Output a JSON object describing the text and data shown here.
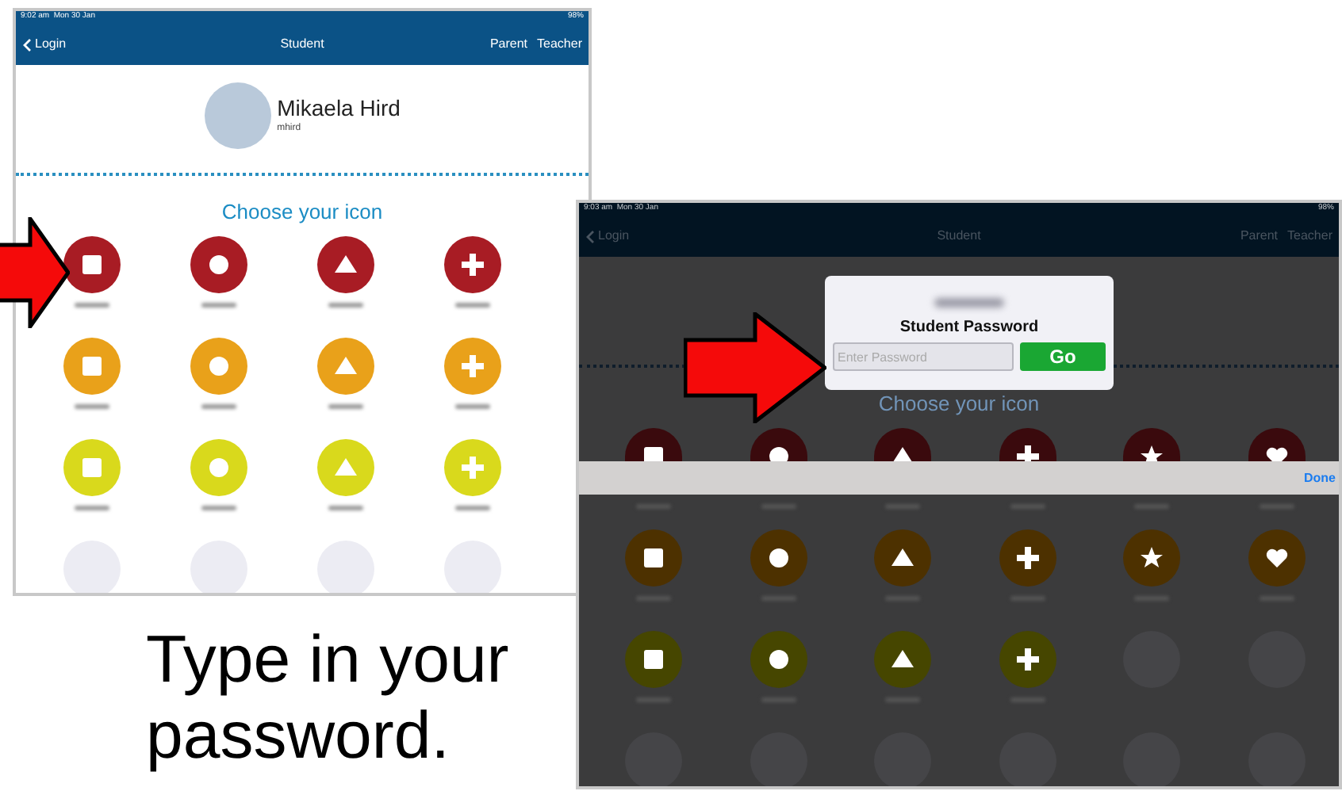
{
  "left_screen": {
    "status_bar": {
      "time": "9:02 am  Mon 30 Jan",
      "battery": "98%"
    },
    "nav": {
      "back": "Login",
      "title": "Student",
      "links": [
        "Parent",
        "Teacher"
      ]
    },
    "profile": {
      "name": "Mikaela Hird",
      "username": "mhird"
    },
    "heading": "Choose your icon",
    "icon_rows": [
      [
        {
          "kind": "square",
          "color": "#a81c24"
        },
        {
          "kind": "circle",
          "color": "#a81c24"
        },
        {
          "kind": "triangle",
          "color": "#a81c24"
        },
        {
          "kind": "plus",
          "color": "#a81c24"
        }
      ],
      [
        {
          "kind": "square",
          "color": "#e9a11a"
        },
        {
          "kind": "circle",
          "color": "#e9a11a"
        },
        {
          "kind": "triangle",
          "color": "#e9a11a"
        },
        {
          "kind": "plus",
          "color": "#e9a11a"
        }
      ],
      [
        {
          "kind": "square",
          "color": "#d9d91c"
        },
        {
          "kind": "circle",
          "color": "#d9d91c"
        },
        {
          "kind": "triangle",
          "color": "#d9d91c"
        },
        {
          "kind": "plus",
          "color": "#d9d91c"
        }
      ],
      [
        {
          "kind": "empty"
        },
        {
          "kind": "empty"
        },
        {
          "kind": "empty"
        },
        {
          "kind": "empty"
        }
      ]
    ]
  },
  "right_screen": {
    "status_bar": {
      "time": "9:03 am  Mon 30 Jan",
      "battery": "98%"
    },
    "nav": {
      "back": "Login",
      "title": "Student",
      "links": [
        "Parent",
        "Teacher"
      ]
    },
    "dialog": {
      "title": "Student Password",
      "placeholder": "Enter Password",
      "button": "Go"
    },
    "heading": "Choose your icon",
    "toolbar": {
      "button": "Done"
    },
    "icon_rows": [
      [
        {
          "kind": "square",
          "color": "#3a0a0d"
        },
        {
          "kind": "circle",
          "color": "#3a0a0d"
        },
        {
          "kind": "triangle",
          "color": "#3a0a0d"
        },
        {
          "kind": "plus",
          "color": "#3a0a0d"
        },
        {
          "kind": "star",
          "color": "#3a0a0d"
        },
        {
          "kind": "heart",
          "color": "#3a0a0d"
        }
      ],
      [
        {
          "kind": "square",
          "color": "#4d3100"
        },
        {
          "kind": "circle",
          "color": "#4d3100"
        },
        {
          "kind": "triangle",
          "color": "#4d3100"
        },
        {
          "kind": "plus",
          "color": "#4d3100"
        },
        {
          "kind": "star",
          "color": "#4d3100"
        },
        {
          "kind": "heart",
          "color": "#4d3100"
        }
      ],
      [
        {
          "kind": "square",
          "color": "#464600"
        },
        {
          "kind": "circle",
          "color": "#464600"
        },
        {
          "kind": "triangle",
          "color": "#464600"
        },
        {
          "kind": "plus",
          "color": "#464600"
        },
        {
          "kind": "empty"
        },
        {
          "kind": "empty"
        }
      ],
      [
        {
          "kind": "empty"
        },
        {
          "kind": "empty"
        },
        {
          "kind": "empty"
        },
        {
          "kind": "empty"
        },
        {
          "kind": "empty"
        },
        {
          "kind": "empty"
        }
      ]
    ]
  },
  "caption": "Type in your password."
}
